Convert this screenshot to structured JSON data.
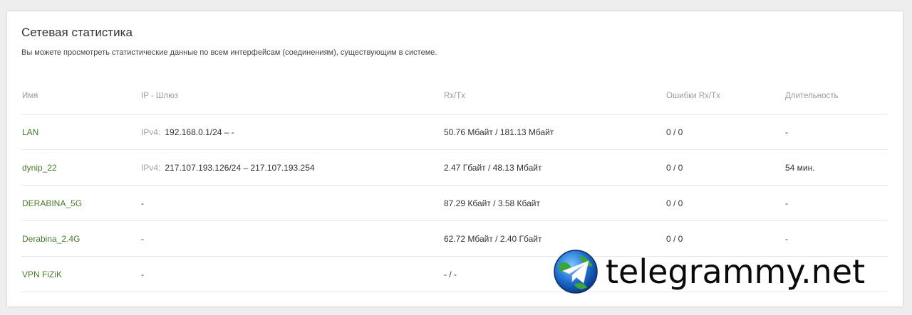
{
  "header": {
    "title": "Сетевая статистика",
    "description": "Вы можете просмотреть статистические данные по всем интерфейсам (соединениям), существующим в системе."
  },
  "table": {
    "columns": [
      "Имя",
      "IP - Шлюз",
      "Rx/Tx",
      "Ошибки Rx/Tx",
      "Длительность"
    ],
    "rows": [
      {
        "name": "LAN",
        "ip_label": "IPv4:",
        "ip": "192.168.0.1/24 – -",
        "rxtx": "50.76 Мбайт / 181.13 Мбайт",
        "errors": "0 / 0",
        "duration": "-"
      },
      {
        "name": "dynip_22",
        "ip_label": "IPv4:",
        "ip": "217.107.193.126/24 – 217.107.193.254",
        "rxtx": "2.47 Гбайт / 48.13 Мбайт",
        "errors": "0 / 0",
        "duration": "54 мин."
      },
      {
        "name": "DERABINA_5G",
        "ip_label": "",
        "ip": "-",
        "rxtx": "87.29 Кбайт / 3.58 Кбайт",
        "errors": "0 / 0",
        "duration": "-"
      },
      {
        "name": "Derabina_2.4G",
        "ip_label": "",
        "ip": "-",
        "rxtx": "62.72 Мбайт / 2.40 Гбайт",
        "errors": "0 / 0",
        "duration": "-"
      },
      {
        "name": "VPN FiZiK",
        "ip_label": "",
        "ip": "-",
        "rxtx": "- / -",
        "errors": "",
        "duration": ""
      }
    ]
  },
  "watermark": {
    "text": "telegrammy.net",
    "icon": "telegram-globe-icon",
    "colors": {
      "globe_blue": "#1e6fd0",
      "globe_green": "#3aa53a",
      "plane": "#ffffff"
    }
  }
}
